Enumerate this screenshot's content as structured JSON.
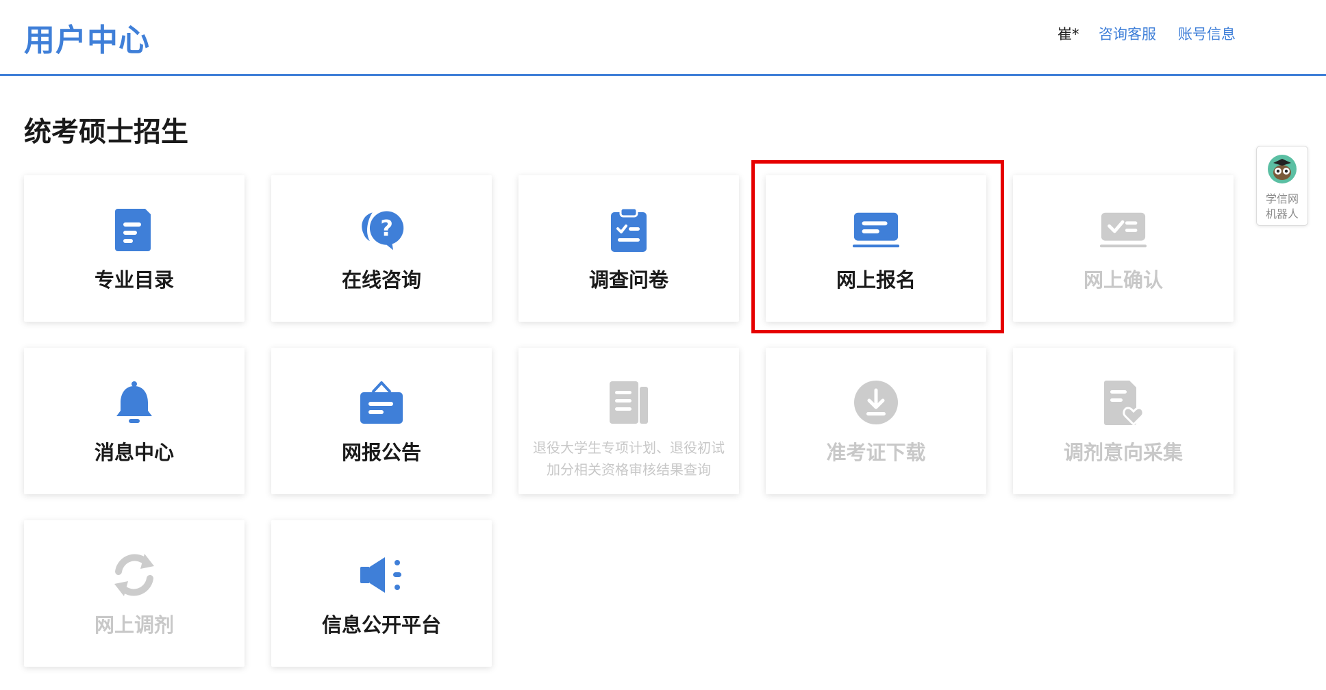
{
  "header": {
    "title": "用户中心",
    "user": "崔*",
    "links": [
      "咨询客服",
      "账号信息"
    ]
  },
  "section_title": "统考硕士招生",
  "cards": [
    {
      "label": "专业目录",
      "icon": "catalog-icon",
      "enabled": true
    },
    {
      "label": "在线咨询",
      "icon": "consult-question-icon",
      "enabled": true
    },
    {
      "label": "调查问卷",
      "icon": "clipboard-check-icon",
      "enabled": true
    },
    {
      "label": "网上报名",
      "icon": "card-register-icon",
      "enabled": true,
      "highlighted": true
    },
    {
      "label": "网上确认",
      "icon": "confirm-check-icon",
      "enabled": false
    },
    {
      "label": "消息中心",
      "icon": "bell-icon",
      "enabled": true
    },
    {
      "label": "网报公告",
      "icon": "notice-board-icon",
      "enabled": true
    },
    {
      "label": "退役大学生专项计划、退役初试加分相关资格审核结果查询",
      "icon": "document-list-icon",
      "enabled": false
    },
    {
      "label": "准考证下载",
      "icon": "download-circle-icon",
      "enabled": false
    },
    {
      "label": "调剂意向采集",
      "icon": "document-heart-icon",
      "enabled": false
    },
    {
      "label": "网上调剂",
      "icon": "refresh-icon",
      "enabled": false
    },
    {
      "label": "信息公开平台",
      "icon": "megaphone-icon",
      "enabled": true
    }
  ],
  "robot": {
    "line1": "学信网",
    "line2": "机器人",
    "icon": "robot-avatar-icon"
  },
  "colors": {
    "primary": "#3f7fd8",
    "disabled": "#c8c8c8",
    "highlight": "#e60000"
  }
}
